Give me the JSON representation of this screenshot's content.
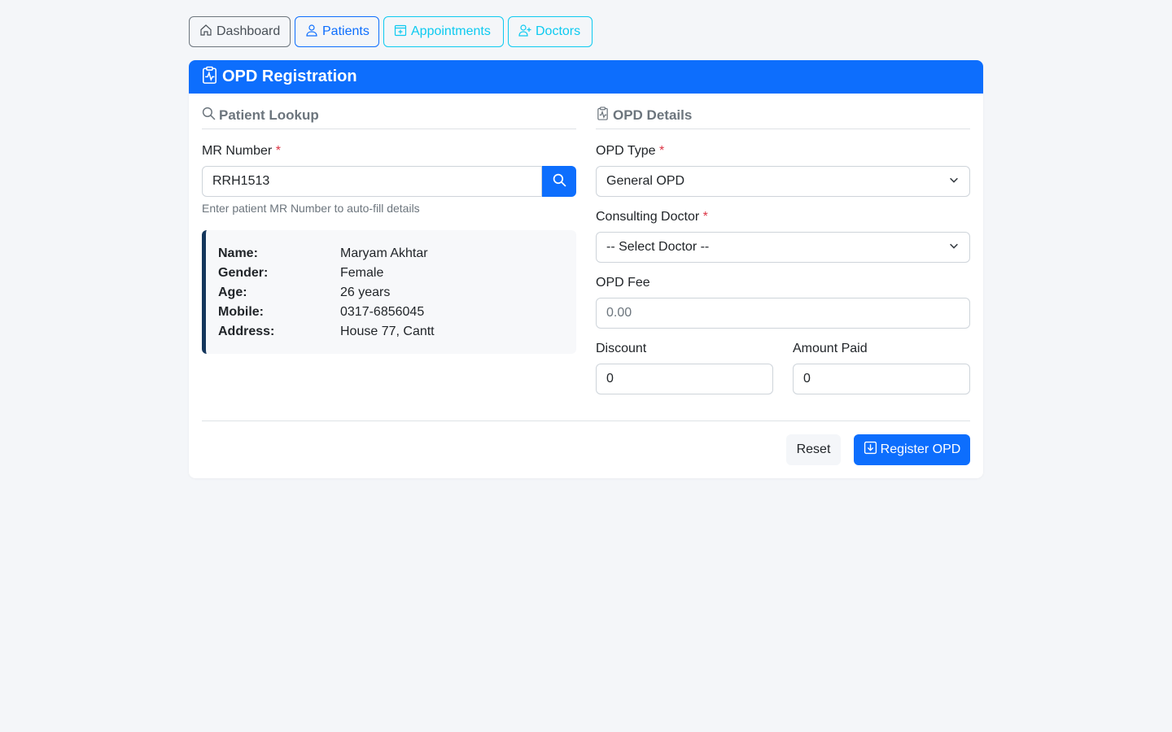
{
  "nav": {
    "dashboard": "Dashboard",
    "patients": "Patients",
    "appointments": "Appointments",
    "doctors": "Doctors"
  },
  "card": {
    "title": "OPD Registration"
  },
  "lookup": {
    "section_title": "Patient Lookup",
    "mr_label": "MR Number",
    "required_mark": "*",
    "mr_value": "RRH1513",
    "help_text": "Enter patient MR Number to auto-fill details"
  },
  "patient": {
    "rows": [
      {
        "key": "Name:",
        "value": "Maryam Akhtar"
      },
      {
        "key": "Gender:",
        "value": "Female"
      },
      {
        "key": "Age:",
        "value": "26 years"
      },
      {
        "key": "Mobile:",
        "value": "0317-6856045"
      },
      {
        "key": "Address:",
        "value": "House 77, Cantt"
      }
    ]
  },
  "opd": {
    "section_title": "OPD Details",
    "type_label": "OPD Type",
    "type_value": "General OPD",
    "doctor_label": "Consulting Doctor",
    "doctor_value": "-- Select Doctor --",
    "fee_label": "OPD Fee",
    "fee_placeholder": "0.00",
    "discount_label": "Discount",
    "discount_value": "0",
    "paid_label": "Amount Paid",
    "paid_value": "0"
  },
  "actions": {
    "reset": "Reset",
    "register": "Register OPD"
  },
  "colors": {
    "primary": "#0d6efd",
    "info": "#0dcaf0",
    "secondary": "#6c757d",
    "danger": "#dc3545",
    "patient_accent": "#14365c"
  }
}
